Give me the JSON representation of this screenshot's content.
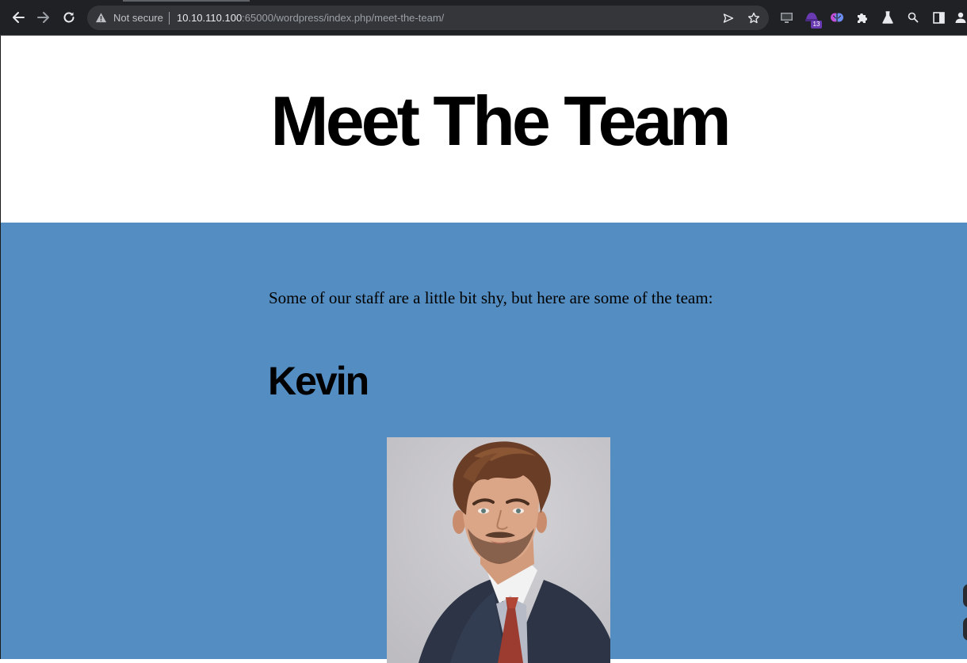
{
  "browser": {
    "nav": {
      "back_icon": "arrow-left-icon",
      "forward_icon": "arrow-right-icon",
      "reload_icon": "reload-icon"
    },
    "address_bar": {
      "security_icon": "warning-triangle-icon",
      "security_text": "Not secure",
      "url_host": "10.10.110.100",
      "url_rest": ":65000/wordpress/index.php/meet-the-team/"
    },
    "extensions": {
      "badge_count": "13"
    }
  },
  "page": {
    "title": "Meet The Team",
    "intro": "Some of our staff are a little bit shy, but here are some of the team:",
    "members": [
      {
        "name": "Kevin"
      }
    ]
  },
  "colors": {
    "content_background": "#538dc1",
    "chrome_background": "#202124",
    "omnibox_background": "#35363a"
  }
}
